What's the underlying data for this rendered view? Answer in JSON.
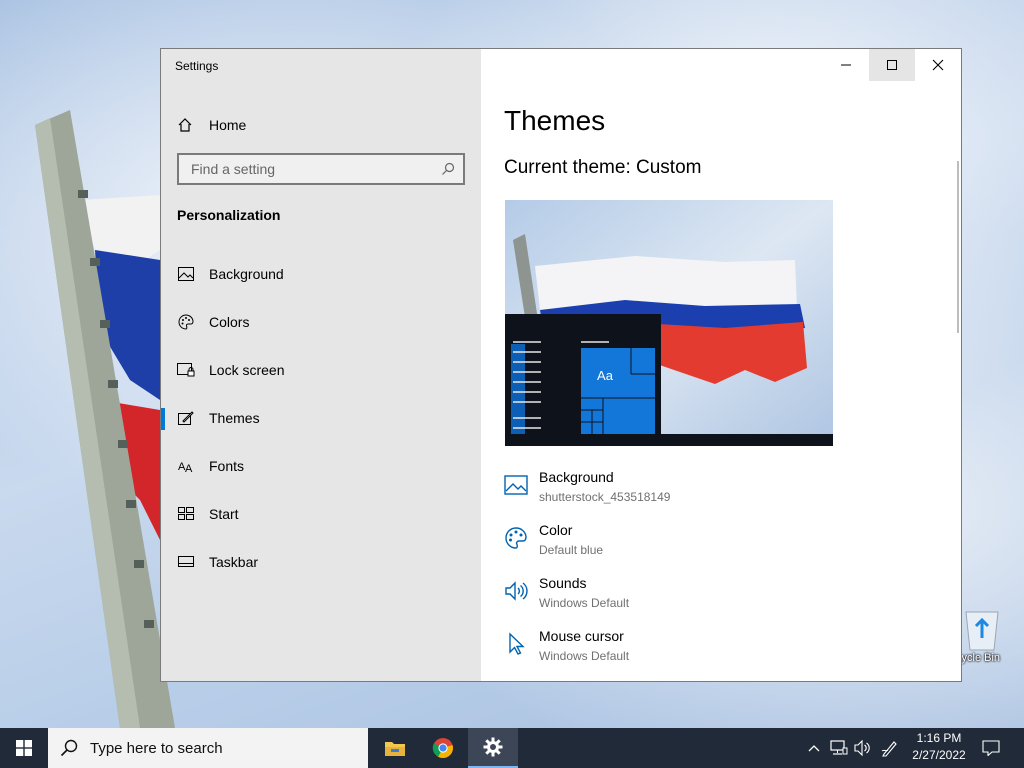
{
  "window": {
    "title": "Settings"
  },
  "sidebar": {
    "home_label": "Home",
    "search_placeholder": "Find a setting",
    "section_title": "Personalization",
    "items": [
      {
        "label": "Background",
        "icon": "picture-icon"
      },
      {
        "label": "Colors",
        "icon": "palette-icon"
      },
      {
        "label": "Lock screen",
        "icon": "lock-screen-icon"
      },
      {
        "label": "Themes",
        "icon": "brush-icon",
        "active": true
      },
      {
        "label": "Fonts",
        "icon": "fonts-icon"
      },
      {
        "label": "Start",
        "icon": "start-tiles-icon"
      },
      {
        "label": "Taskbar",
        "icon": "taskbar-icon"
      }
    ]
  },
  "main": {
    "page_title": "Themes",
    "current_theme": "Current theme: Custom",
    "preview_sample_text": "Aa",
    "properties": [
      {
        "title": "Background",
        "value": "shutterstock_453518149",
        "icon": "picture-icon"
      },
      {
        "title": "Color",
        "value": "Default blue",
        "icon": "palette-icon"
      },
      {
        "title": "Sounds",
        "value": "Windows Default",
        "icon": "speaker-icon"
      },
      {
        "title": "Mouse cursor",
        "value": "Windows Default",
        "icon": "cursor-icon"
      }
    ]
  },
  "desktop": {
    "recycle_bin_label": "cycle Bin"
  },
  "taskbar": {
    "search_placeholder": "Type here to search",
    "time": "1:16 PM",
    "date": "2/27/2022"
  },
  "colors": {
    "accent": "#0078d7",
    "taskbar": "#202a38",
    "sidebar": "#e6e6e6"
  }
}
